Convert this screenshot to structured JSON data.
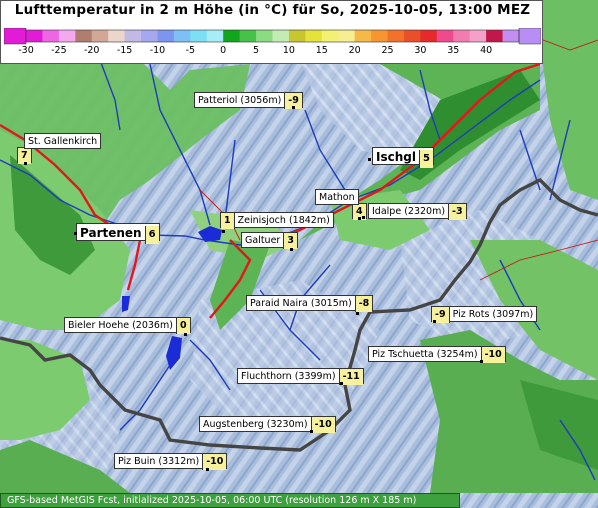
{
  "title": "Lufttemperatur in 2 m Höhe (in °C) für So, 2025-10-05, 13:00 MEZ",
  "colorbar": {
    "ticks": [
      "-30",
      "-25",
      "-20",
      "-15",
      "-10",
      "-5",
      "0",
      "5",
      "10",
      "15",
      "20",
      "25",
      "30",
      "35",
      "40"
    ],
    "colors": [
      "#e21bd6",
      "#ee66e4",
      "#f4a9ee",
      "#b07e6f",
      "#d1a897",
      "#ecd6cc",
      "#c3b9e5",
      "#a5a8ee",
      "#7c95f0",
      "#7dc0f5",
      "#7ddff4",
      "#a8ecf5",
      "#11a61c",
      "#46c24a",
      "#8bdb80",
      "#c3ecb5",
      "#c8c62e",
      "#e5e33a",
      "#f2f171",
      "#f6ee8f",
      "#f6b846",
      "#f79530",
      "#f2722b",
      "#ea4f2a",
      "#e62a2c",
      "#f04a8f",
      "#f27cb0",
      "#f3a1c8",
      "#c2174b",
      "#c28ef2"
    ],
    "under_color": "#e21bd6",
    "over_color": "#b78ef4"
  },
  "labels": [
    {
      "name": "Patteriol (3056m)",
      "value": "-9"
    },
    {
      "name": "St. Gallenkirch",
      "value": "7"
    },
    {
      "name": "Ischgl",
      "value": "5"
    },
    {
      "name": "Mathon",
      "value": "4"
    },
    {
      "name": "Idalpe (2320m)",
      "value": "-3"
    },
    {
      "name": "Zeinisjoch (1842m)",
      "value": "1"
    },
    {
      "name": "Partenen",
      "value": "6"
    },
    {
      "name": "Galtuer",
      "value": "3"
    },
    {
      "name": "Paraid Naira (3015m)",
      "value": "-8"
    },
    {
      "name": "Piz Rots (3097m)",
      "value": "-9"
    },
    {
      "name": "Bieler Hoehe (2036m)",
      "value": "0"
    },
    {
      "name": "Piz Tschuetta (3254m)",
      "value": "-10"
    },
    {
      "name": "Fluchthorn (3399m)",
      "value": "-11"
    },
    {
      "name": "Augstenberg (3230m)",
      "value": "-10"
    },
    {
      "name": "Piz Buin (3312m)",
      "value": "-10"
    }
  ],
  "footer": "GFS-based MetGIS Fcst, initialized 2025-10-05, 06:00 UTC  (resolution 126 m X 185 m)"
}
